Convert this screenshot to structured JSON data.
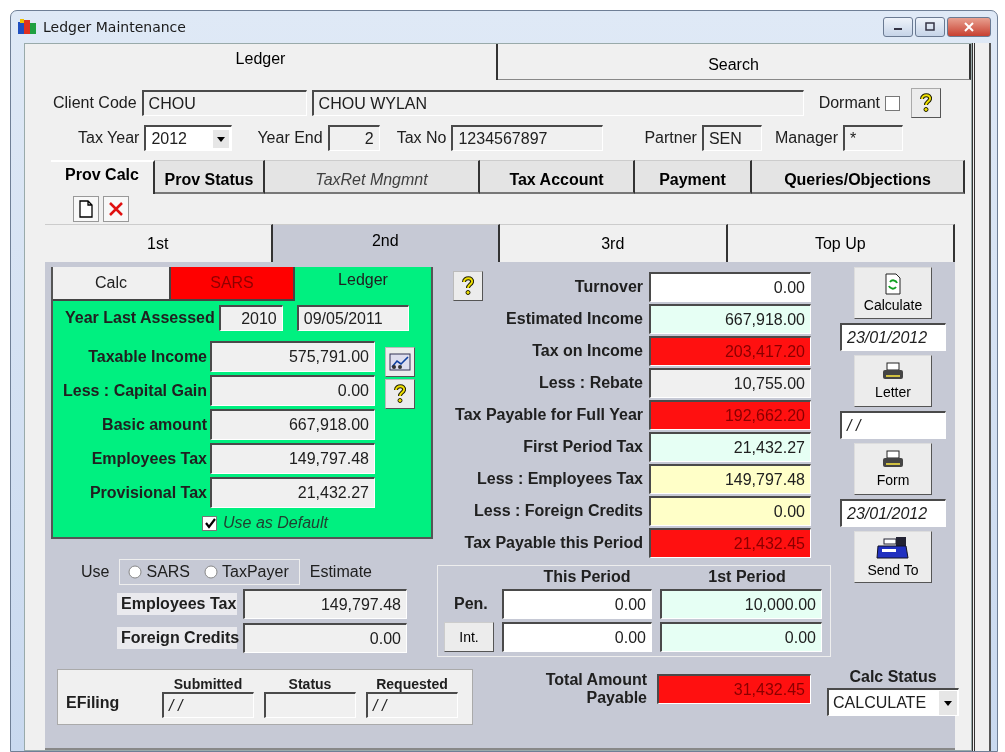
{
  "window": {
    "title": "Ledger Maintenance"
  },
  "main_tabs": [
    {
      "label": "Ledger",
      "selected": true
    },
    {
      "label": "Search",
      "selected": false
    }
  ],
  "client": {
    "code_label": "Client Code",
    "code": "CHOU",
    "name": "CHOU WYLAN",
    "dormant_label": "Dormant",
    "dormant": false
  },
  "tax_info": [
    {
      "kind": "select",
      "label": "Tax Year",
      "value": "2012"
    },
    {
      "kind": "number",
      "label": "Year End",
      "value": "2"
    },
    {
      "kind": "text",
      "label": "Tax No",
      "value": "1234567897"
    },
    {
      "kind": "text",
      "label": "Partner",
      "value": "SEN"
    },
    {
      "kind": "text",
      "label": "Manager",
      "value": "*"
    }
  ],
  "section_tabs": [
    {
      "label": "Prov Calc",
      "selected": true,
      "disabled": false
    },
    {
      "label": "Prov Status",
      "selected": false,
      "disabled": false
    },
    {
      "label": "TaxRet Mngmnt",
      "selected": false,
      "disabled": true
    },
    {
      "label": "Tax Account",
      "selected": false,
      "disabled": false
    },
    {
      "label": "Payment",
      "selected": false,
      "disabled": false
    },
    {
      "label": "Queries/Objections",
      "selected": false,
      "disabled": false
    }
  ],
  "period_tabs": [
    {
      "label": "1st",
      "selected": false
    },
    {
      "label": "2nd",
      "selected": true
    },
    {
      "label": "3rd",
      "selected": false
    },
    {
      "label": "Top Up",
      "selected": false
    }
  ],
  "source_tabs": [
    {
      "label": "Calc",
      "selected": false,
      "color": "#f0f0f0"
    },
    {
      "label": "SARS",
      "selected": false,
      "color": "#ff0000"
    },
    {
      "label": "Ledger",
      "selected": true,
      "color": "#00f080"
    }
  ],
  "ledger": {
    "assessed_label": "Year Last Assessed",
    "assessed_year": "2010",
    "assessed_date": "09/05/2011",
    "rows": [
      {
        "label": "Taxable Income",
        "value": "575,791.00"
      },
      {
        "label": "Less : Capital Gain",
        "value": "0.00"
      },
      {
        "label": "Basic amount",
        "value": "667,918.00"
      },
      {
        "label": "Employees Tax",
        "value": "149,797.48"
      },
      {
        "label": "Provisional Tax",
        "value": "21,432.27"
      }
    ],
    "default_label": "Use as Default",
    "use_as_default": true
  },
  "use": {
    "label": "Use",
    "options": [
      {
        "label": "SARS",
        "selected": false
      },
      {
        "label": "TaxPayer",
        "selected": false
      }
    ],
    "estimate_label": "Estimate",
    "rows": [
      {
        "label": "Employees Tax",
        "value": "149,797.48"
      },
      {
        "label": "Foreign Credits",
        "value": "0.00"
      }
    ]
  },
  "efiling": {
    "label": "EFiling",
    "columns": [
      {
        "label": "Submitted",
        "value": "/ /"
      },
      {
        "label": "Status"
      },
      {
        "label": "Requested",
        "value": "/ /"
      }
    ]
  },
  "calc_rows": [
    {
      "label": "Turnover",
      "value": "0.00",
      "kind": "input"
    },
    {
      "label": "Estimated Income",
      "value": "667,918.00",
      "kind": "estimate"
    },
    {
      "label": "Tax on Income",
      "value": "203,417.20",
      "kind": "alert"
    },
    {
      "label": "Less : Rebate",
      "value": "10,755.00",
      "kind": "plain"
    },
    {
      "label": "Tax Payable for Full Year",
      "value": "192,662.20",
      "kind": "alert"
    },
    {
      "label": "First Period Tax",
      "value": "21,432.27",
      "kind": "estimate"
    },
    {
      "label": "Less : Employees Tax",
      "value": "149,797.48",
      "kind": "credit"
    },
    {
      "label": "Less : Foreign Credits",
      "value": "0.00",
      "kind": "credit"
    },
    {
      "label": "Tax Payable this Period",
      "value": "21,432.45",
      "kind": "alert"
    }
  ],
  "penalties": {
    "columns": [
      "This Period",
      "1st Period"
    ],
    "rows": [
      {
        "label": "Pen.",
        "kind": "label",
        "values": [
          {
            "value": "0.00",
            "kind": "input"
          },
          {
            "value": "10,000.00",
            "kind": "estimate"
          }
        ]
      },
      {
        "label": "Int.",
        "kind": "button",
        "values": [
          {
            "value": "0.00",
            "kind": "input"
          },
          {
            "value": "0.00",
            "kind": "estimate"
          }
        ]
      }
    ]
  },
  "total": {
    "label": "Total Amount Payable",
    "value": "31,432.45",
    "kind": "alert"
  },
  "actions": [
    {
      "label": "Calculate",
      "kind": "refresh",
      "date": "23/01/2012"
    },
    {
      "label": "Letter",
      "kind": "printer",
      "date": "/ /"
    },
    {
      "label": "Form",
      "kind": "printer",
      "date": "23/01/2012"
    },
    {
      "label": "Send To",
      "kind": "fax"
    }
  ],
  "calc_status": {
    "label": "Calc Status",
    "value": "CALCULATE"
  }
}
